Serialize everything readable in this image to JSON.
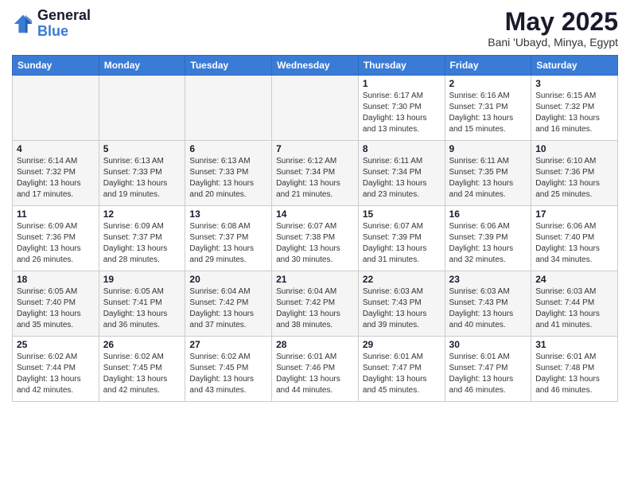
{
  "header": {
    "logo_line1": "General",
    "logo_line2": "Blue",
    "title": "May 2025",
    "subtitle": "Bani 'Ubayd, Minya, Egypt"
  },
  "days_of_week": [
    "Sunday",
    "Monday",
    "Tuesday",
    "Wednesday",
    "Thursday",
    "Friday",
    "Saturday"
  ],
  "weeks": [
    [
      {
        "day": "",
        "info": ""
      },
      {
        "day": "",
        "info": ""
      },
      {
        "day": "",
        "info": ""
      },
      {
        "day": "",
        "info": ""
      },
      {
        "day": "1",
        "info": "Sunrise: 6:17 AM\nSunset: 7:30 PM\nDaylight: 13 hours\nand 13 minutes."
      },
      {
        "day": "2",
        "info": "Sunrise: 6:16 AM\nSunset: 7:31 PM\nDaylight: 13 hours\nand 15 minutes."
      },
      {
        "day": "3",
        "info": "Sunrise: 6:15 AM\nSunset: 7:32 PM\nDaylight: 13 hours\nand 16 minutes."
      }
    ],
    [
      {
        "day": "4",
        "info": "Sunrise: 6:14 AM\nSunset: 7:32 PM\nDaylight: 13 hours\nand 17 minutes."
      },
      {
        "day": "5",
        "info": "Sunrise: 6:13 AM\nSunset: 7:33 PM\nDaylight: 13 hours\nand 19 minutes."
      },
      {
        "day": "6",
        "info": "Sunrise: 6:13 AM\nSunset: 7:33 PM\nDaylight: 13 hours\nand 20 minutes."
      },
      {
        "day": "7",
        "info": "Sunrise: 6:12 AM\nSunset: 7:34 PM\nDaylight: 13 hours\nand 21 minutes."
      },
      {
        "day": "8",
        "info": "Sunrise: 6:11 AM\nSunset: 7:34 PM\nDaylight: 13 hours\nand 23 minutes."
      },
      {
        "day": "9",
        "info": "Sunrise: 6:11 AM\nSunset: 7:35 PM\nDaylight: 13 hours\nand 24 minutes."
      },
      {
        "day": "10",
        "info": "Sunrise: 6:10 AM\nSunset: 7:36 PM\nDaylight: 13 hours\nand 25 minutes."
      }
    ],
    [
      {
        "day": "11",
        "info": "Sunrise: 6:09 AM\nSunset: 7:36 PM\nDaylight: 13 hours\nand 26 minutes."
      },
      {
        "day": "12",
        "info": "Sunrise: 6:09 AM\nSunset: 7:37 PM\nDaylight: 13 hours\nand 28 minutes."
      },
      {
        "day": "13",
        "info": "Sunrise: 6:08 AM\nSunset: 7:37 PM\nDaylight: 13 hours\nand 29 minutes."
      },
      {
        "day": "14",
        "info": "Sunrise: 6:07 AM\nSunset: 7:38 PM\nDaylight: 13 hours\nand 30 minutes."
      },
      {
        "day": "15",
        "info": "Sunrise: 6:07 AM\nSunset: 7:39 PM\nDaylight: 13 hours\nand 31 minutes."
      },
      {
        "day": "16",
        "info": "Sunrise: 6:06 AM\nSunset: 7:39 PM\nDaylight: 13 hours\nand 32 minutes."
      },
      {
        "day": "17",
        "info": "Sunrise: 6:06 AM\nSunset: 7:40 PM\nDaylight: 13 hours\nand 34 minutes."
      }
    ],
    [
      {
        "day": "18",
        "info": "Sunrise: 6:05 AM\nSunset: 7:40 PM\nDaylight: 13 hours\nand 35 minutes."
      },
      {
        "day": "19",
        "info": "Sunrise: 6:05 AM\nSunset: 7:41 PM\nDaylight: 13 hours\nand 36 minutes."
      },
      {
        "day": "20",
        "info": "Sunrise: 6:04 AM\nSunset: 7:42 PM\nDaylight: 13 hours\nand 37 minutes."
      },
      {
        "day": "21",
        "info": "Sunrise: 6:04 AM\nSunset: 7:42 PM\nDaylight: 13 hours\nand 38 minutes."
      },
      {
        "day": "22",
        "info": "Sunrise: 6:03 AM\nSunset: 7:43 PM\nDaylight: 13 hours\nand 39 minutes."
      },
      {
        "day": "23",
        "info": "Sunrise: 6:03 AM\nSunset: 7:43 PM\nDaylight: 13 hours\nand 40 minutes."
      },
      {
        "day": "24",
        "info": "Sunrise: 6:03 AM\nSunset: 7:44 PM\nDaylight: 13 hours\nand 41 minutes."
      }
    ],
    [
      {
        "day": "25",
        "info": "Sunrise: 6:02 AM\nSunset: 7:44 PM\nDaylight: 13 hours\nand 42 minutes."
      },
      {
        "day": "26",
        "info": "Sunrise: 6:02 AM\nSunset: 7:45 PM\nDaylight: 13 hours\nand 42 minutes."
      },
      {
        "day": "27",
        "info": "Sunrise: 6:02 AM\nSunset: 7:45 PM\nDaylight: 13 hours\nand 43 minutes."
      },
      {
        "day": "28",
        "info": "Sunrise: 6:01 AM\nSunset: 7:46 PM\nDaylight: 13 hours\nand 44 minutes."
      },
      {
        "day": "29",
        "info": "Sunrise: 6:01 AM\nSunset: 7:47 PM\nDaylight: 13 hours\nand 45 minutes."
      },
      {
        "day": "30",
        "info": "Sunrise: 6:01 AM\nSunset: 7:47 PM\nDaylight: 13 hours\nand 46 minutes."
      },
      {
        "day": "31",
        "info": "Sunrise: 6:01 AM\nSunset: 7:48 PM\nDaylight: 13 hours\nand 46 minutes."
      }
    ]
  ]
}
